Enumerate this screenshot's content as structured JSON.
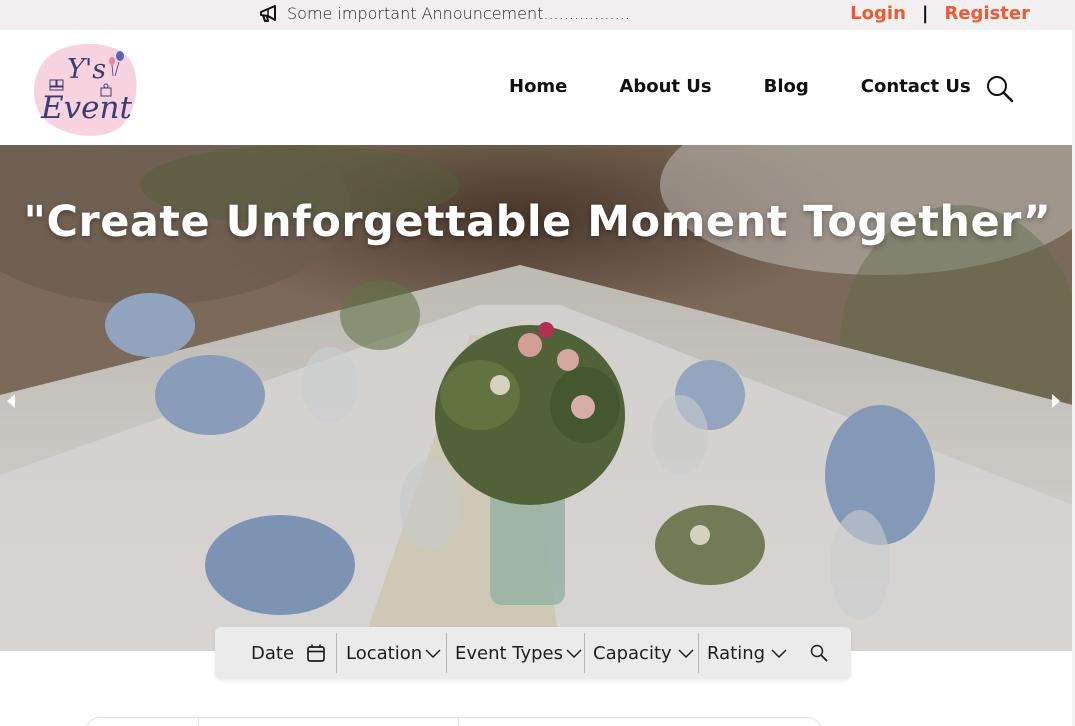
{
  "announcement": {
    "text": "Some important Announcement.................",
    "icon": "megaphone-icon"
  },
  "auth": {
    "login": "Login",
    "separator": "|",
    "register": "Register",
    "color": "#ea5a34"
  },
  "logo": {
    "line1": "Y's",
    "line2": "Event",
    "color": "#3a3d75",
    "blob_color": "#f6d3de"
  },
  "nav": {
    "items": [
      "Home",
      "About Us",
      "Blog",
      "Contact Us"
    ],
    "search_icon": "search-icon"
  },
  "hero": {
    "title": "\"Create Unforgettable Moment Together”",
    "prev_icon": "caret-left-icon",
    "next_icon": "caret-right-icon"
  },
  "filters": {
    "date": "Date",
    "location": "Location",
    "event_types": "Event Types",
    "capacity": "Capacity",
    "rating": "Rating"
  }
}
